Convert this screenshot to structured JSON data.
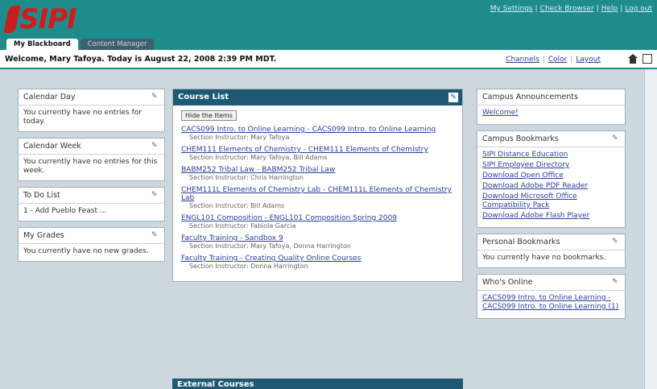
{
  "header": {
    "logo": "SIPI",
    "toplinks": [
      "My Settings",
      "Check Browser",
      "Help",
      "Log out"
    ],
    "tabs": [
      "My Blackboard",
      "Content Manager"
    ]
  },
  "welcome": {
    "text": "Welcome, Mary Tafoya. Today is August 22, 2008 2:39 PM MDT.",
    "links": [
      "Channels",
      "Color",
      "Layout"
    ]
  },
  "left": {
    "calendar_day": {
      "title": "Calendar Day",
      "body": "You currently have no entries for today."
    },
    "calendar_week": {
      "title": "Calendar Week",
      "body": "You currently have no entries for this week."
    },
    "todo": {
      "title": "To Do List",
      "body": "1 - Add Pueblo Feast ..."
    },
    "grades": {
      "title": "My Grades",
      "body": "You currently have no new grades."
    }
  },
  "course_list": {
    "title": "Course List",
    "button": "Hide the Items",
    "courses": [
      {
        "name": "CACS099 Intro. to Online Learning - CACS099 Intro. to Online Learning",
        "instructor": "Section Instructor: Mary Tafoya"
      },
      {
        "name": "CHEM111 Elements of Chemistry - CHEM111 Elements of Chemistry",
        "instructor": "Section Instructor: Mary Tafoya, Bill Adams"
      },
      {
        "name": "BABM252 Tribal Law - BABM252 Tribal Law",
        "instructor": "Section Instructor: Chris Harrington"
      },
      {
        "name": "CHEM111L Elements of Chemistry Lab - CHEM111L Elements of Chemistry Lab",
        "instructor": "Section Instructor: Bill Adams"
      },
      {
        "name": "ENGL101 Composition - ENGL101 Composition Spring 2009",
        "instructor": "Section Instructor: Fabiola Garcia"
      },
      {
        "name": "Faculty Training - Sandbox 9",
        "instructor": "Section Instructor: Mary Tafoya, Donna Harrington"
      },
      {
        "name": "Faculty Training - Creating Quality Online Courses",
        "instructor": "Section Instructor: Donna Harrington"
      }
    ]
  },
  "external_courses": {
    "title": "External Courses"
  },
  "right": {
    "announcements": {
      "title": "Campus Announcements",
      "link": "Welcome!"
    },
    "bookmarks": {
      "title": "Campus Bookmarks",
      "links": [
        "SIPI Distance Education",
        "SIPI Employee Directory",
        "Download Open Office",
        "Download Adobe PDF Reader",
        "Download Microsoft Office Compatibility Pack",
        "Download Adobe Flash Player"
      ]
    },
    "personal": {
      "title": "Personal Bookmarks",
      "body": "You currently have no bookmarks."
    },
    "online": {
      "title": "Who's Online",
      "link": "CACS099 Intro. to Online Learning - CACS099 Intro. to Online Learning (1)"
    }
  },
  "colors": {
    "header": "#1f8c8c",
    "course_head": "#1f5873",
    "link": "#2a3f9a",
    "logo": "#d01c1c"
  }
}
